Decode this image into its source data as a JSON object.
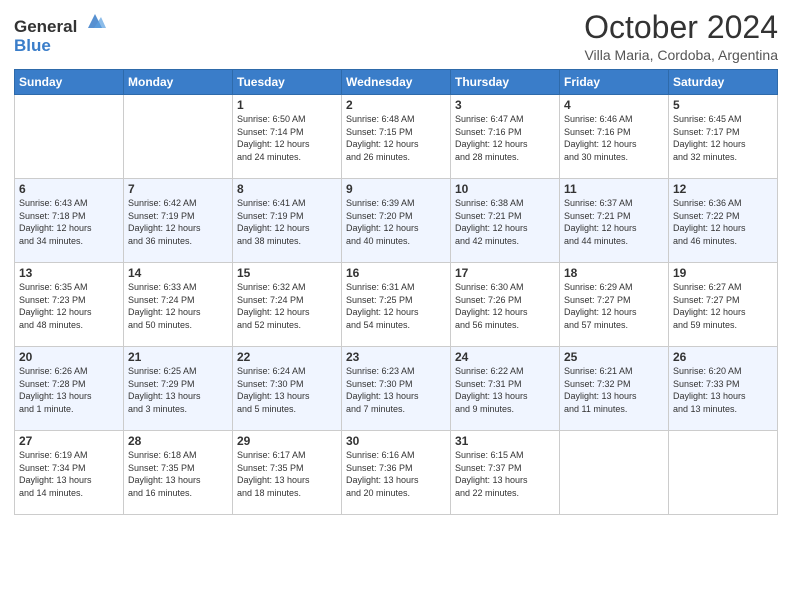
{
  "logo": {
    "text_general": "General",
    "text_blue": "Blue"
  },
  "header": {
    "month": "October 2024",
    "location": "Villa Maria, Cordoba, Argentina"
  },
  "weekdays": [
    "Sunday",
    "Monday",
    "Tuesday",
    "Wednesday",
    "Thursday",
    "Friday",
    "Saturday"
  ],
  "weeks": [
    [
      {
        "day": "",
        "info": ""
      },
      {
        "day": "",
        "info": ""
      },
      {
        "day": "1",
        "info": "Sunrise: 6:50 AM\nSunset: 7:14 PM\nDaylight: 12 hours\nand 24 minutes."
      },
      {
        "day": "2",
        "info": "Sunrise: 6:48 AM\nSunset: 7:15 PM\nDaylight: 12 hours\nand 26 minutes."
      },
      {
        "day": "3",
        "info": "Sunrise: 6:47 AM\nSunset: 7:16 PM\nDaylight: 12 hours\nand 28 minutes."
      },
      {
        "day": "4",
        "info": "Sunrise: 6:46 AM\nSunset: 7:16 PM\nDaylight: 12 hours\nand 30 minutes."
      },
      {
        "day": "5",
        "info": "Sunrise: 6:45 AM\nSunset: 7:17 PM\nDaylight: 12 hours\nand 32 minutes."
      }
    ],
    [
      {
        "day": "6",
        "info": "Sunrise: 6:43 AM\nSunset: 7:18 PM\nDaylight: 12 hours\nand 34 minutes."
      },
      {
        "day": "7",
        "info": "Sunrise: 6:42 AM\nSunset: 7:19 PM\nDaylight: 12 hours\nand 36 minutes."
      },
      {
        "day": "8",
        "info": "Sunrise: 6:41 AM\nSunset: 7:19 PM\nDaylight: 12 hours\nand 38 minutes."
      },
      {
        "day": "9",
        "info": "Sunrise: 6:39 AM\nSunset: 7:20 PM\nDaylight: 12 hours\nand 40 minutes."
      },
      {
        "day": "10",
        "info": "Sunrise: 6:38 AM\nSunset: 7:21 PM\nDaylight: 12 hours\nand 42 minutes."
      },
      {
        "day": "11",
        "info": "Sunrise: 6:37 AM\nSunset: 7:21 PM\nDaylight: 12 hours\nand 44 minutes."
      },
      {
        "day": "12",
        "info": "Sunrise: 6:36 AM\nSunset: 7:22 PM\nDaylight: 12 hours\nand 46 minutes."
      }
    ],
    [
      {
        "day": "13",
        "info": "Sunrise: 6:35 AM\nSunset: 7:23 PM\nDaylight: 12 hours\nand 48 minutes."
      },
      {
        "day": "14",
        "info": "Sunrise: 6:33 AM\nSunset: 7:24 PM\nDaylight: 12 hours\nand 50 minutes."
      },
      {
        "day": "15",
        "info": "Sunrise: 6:32 AM\nSunset: 7:24 PM\nDaylight: 12 hours\nand 52 minutes."
      },
      {
        "day": "16",
        "info": "Sunrise: 6:31 AM\nSunset: 7:25 PM\nDaylight: 12 hours\nand 54 minutes."
      },
      {
        "day": "17",
        "info": "Sunrise: 6:30 AM\nSunset: 7:26 PM\nDaylight: 12 hours\nand 56 minutes."
      },
      {
        "day": "18",
        "info": "Sunrise: 6:29 AM\nSunset: 7:27 PM\nDaylight: 12 hours\nand 57 minutes."
      },
      {
        "day": "19",
        "info": "Sunrise: 6:27 AM\nSunset: 7:27 PM\nDaylight: 12 hours\nand 59 minutes."
      }
    ],
    [
      {
        "day": "20",
        "info": "Sunrise: 6:26 AM\nSunset: 7:28 PM\nDaylight: 13 hours\nand 1 minute."
      },
      {
        "day": "21",
        "info": "Sunrise: 6:25 AM\nSunset: 7:29 PM\nDaylight: 13 hours\nand 3 minutes."
      },
      {
        "day": "22",
        "info": "Sunrise: 6:24 AM\nSunset: 7:30 PM\nDaylight: 13 hours\nand 5 minutes."
      },
      {
        "day": "23",
        "info": "Sunrise: 6:23 AM\nSunset: 7:30 PM\nDaylight: 13 hours\nand 7 minutes."
      },
      {
        "day": "24",
        "info": "Sunrise: 6:22 AM\nSunset: 7:31 PM\nDaylight: 13 hours\nand 9 minutes."
      },
      {
        "day": "25",
        "info": "Sunrise: 6:21 AM\nSunset: 7:32 PM\nDaylight: 13 hours\nand 11 minutes."
      },
      {
        "day": "26",
        "info": "Sunrise: 6:20 AM\nSunset: 7:33 PM\nDaylight: 13 hours\nand 13 minutes."
      }
    ],
    [
      {
        "day": "27",
        "info": "Sunrise: 6:19 AM\nSunset: 7:34 PM\nDaylight: 13 hours\nand 14 minutes."
      },
      {
        "day": "28",
        "info": "Sunrise: 6:18 AM\nSunset: 7:35 PM\nDaylight: 13 hours\nand 16 minutes."
      },
      {
        "day": "29",
        "info": "Sunrise: 6:17 AM\nSunset: 7:35 PM\nDaylight: 13 hours\nand 18 minutes."
      },
      {
        "day": "30",
        "info": "Sunrise: 6:16 AM\nSunset: 7:36 PM\nDaylight: 13 hours\nand 20 minutes."
      },
      {
        "day": "31",
        "info": "Sunrise: 6:15 AM\nSunset: 7:37 PM\nDaylight: 13 hours\nand 22 minutes."
      },
      {
        "day": "",
        "info": ""
      },
      {
        "day": "",
        "info": ""
      }
    ]
  ]
}
